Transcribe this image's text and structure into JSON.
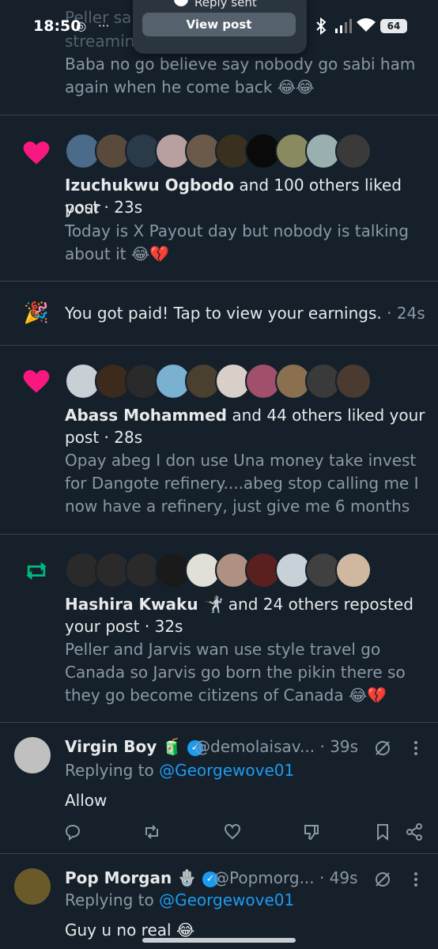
{
  "status_bar": {
    "time": "18:50",
    "dots": "···",
    "battery": "64"
  },
  "toast": {
    "title": "Reply sent",
    "button": "View post"
  },
  "top_partial": {
    "line1": "Peller sa                              s break from",
    "line2": "streamin                           el go Canada...",
    "line3": "Baba no go believe say nobody go sabi ham",
    "line4": "again when he come back 😂😂"
  },
  "notifications": [
    {
      "name": "Izuchukwu Ogbodo",
      "rest": " and 100 others liked your",
      "rest2": "post · 23s",
      "body1": "Today is X Payout day but nobody is talking",
      "body2": "about it 😂💔"
    },
    {
      "text": "You got paid! Tap to view your earnings.",
      "time": " · 24s"
    },
    {
      "name": "Abass Mohammed",
      "rest": " and 44 others liked your",
      "rest2": "post · 28s",
      "body1": "Opay abeg I don use Una money take invest",
      "body2": "for Dangote refinery....abeg stop calling me I",
      "body3": "now have a refinery, just give me 6 months"
    },
    {
      "name": "Hashira Kwaku 🤺",
      "rest": " and 24 others reposted",
      "rest2": "your post · 32s",
      "body1": "Peller and Jarvis wan use style travel go",
      "body2": "Canada so Jarvis go born the pikin there so",
      "body3": "they go become citizens of Canada 😂💔"
    }
  ],
  "replies": [
    {
      "name": "Virgin Boy 🧃",
      "handle": "@demolaisav... · 39s",
      "replying": "Replying to ",
      "mention": "@Georgewove01",
      "text": "Allow"
    },
    {
      "name": "Pop Morgan 🪬",
      "handle": "@Popmorg... · 49s",
      "replying": "Replying to ",
      "mention": "@Georgewove01",
      "text": "Guy u no real 😂"
    }
  ],
  "colors": {
    "bg": "#15202b",
    "like": "#f91880",
    "repost": "#00ba7c",
    "link": "#1d9bf0",
    "muted": "#8b98a5"
  }
}
